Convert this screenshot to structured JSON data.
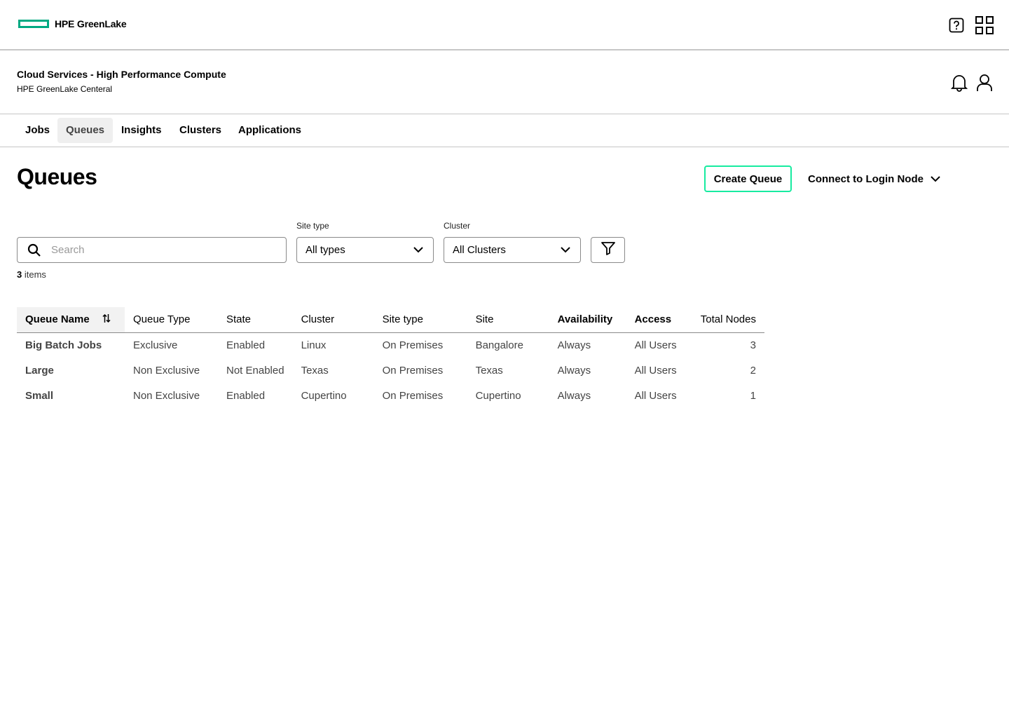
{
  "brand": {
    "name": "HPE GreenLake",
    "color": "#01a982"
  },
  "top_icons": [
    "help-icon",
    "app-grid-icon"
  ],
  "service": {
    "title": "Cloud Services - High Performance Compute",
    "subtitle": "HPE GreenLake Centeral"
  },
  "header_icons": [
    "bell-icon",
    "user-icon"
  ],
  "tabs": [
    {
      "label": "Jobs",
      "active": false
    },
    {
      "label": "Queues",
      "active": true
    },
    {
      "label": "Insights",
      "active": false
    },
    {
      "label": "Clusters",
      "active": false
    },
    {
      "label": "Applications",
      "active": false
    }
  ],
  "page": {
    "title": "Queues",
    "create_label": "Create Queue",
    "connect_label": "Connect to Login Node",
    "accent_color": "#17eba0"
  },
  "filters": {
    "search_placeholder": "Search",
    "site_type_label": "Site type",
    "site_type_value": "All types",
    "cluster_label": "Cluster",
    "cluster_value": "All Clusters"
  },
  "count": {
    "number": "3",
    "suffix": " items"
  },
  "table": {
    "columns": [
      "Queue Name",
      "Queue Type",
      "State",
      "Cluster",
      "Site type",
      "Site",
      "Availability",
      "Access",
      "Total Nodes"
    ],
    "rows": [
      [
        "Big Batch Jobs",
        "Exclusive",
        "Enabled",
        "Linux",
        "On Premises",
        "Bangalore",
        "Always",
        "All Users",
        "3"
      ],
      [
        "Large",
        "Non Exclusive",
        "Not Enabled",
        "Texas",
        "On Premises",
        "Texas",
        "Always",
        "All Users",
        "2"
      ],
      [
        "Small",
        "Non Exclusive",
        "Enabled",
        "Cupertino",
        "On Premises",
        "Cupertino",
        "Always",
        "All Users",
        "1"
      ]
    ]
  }
}
